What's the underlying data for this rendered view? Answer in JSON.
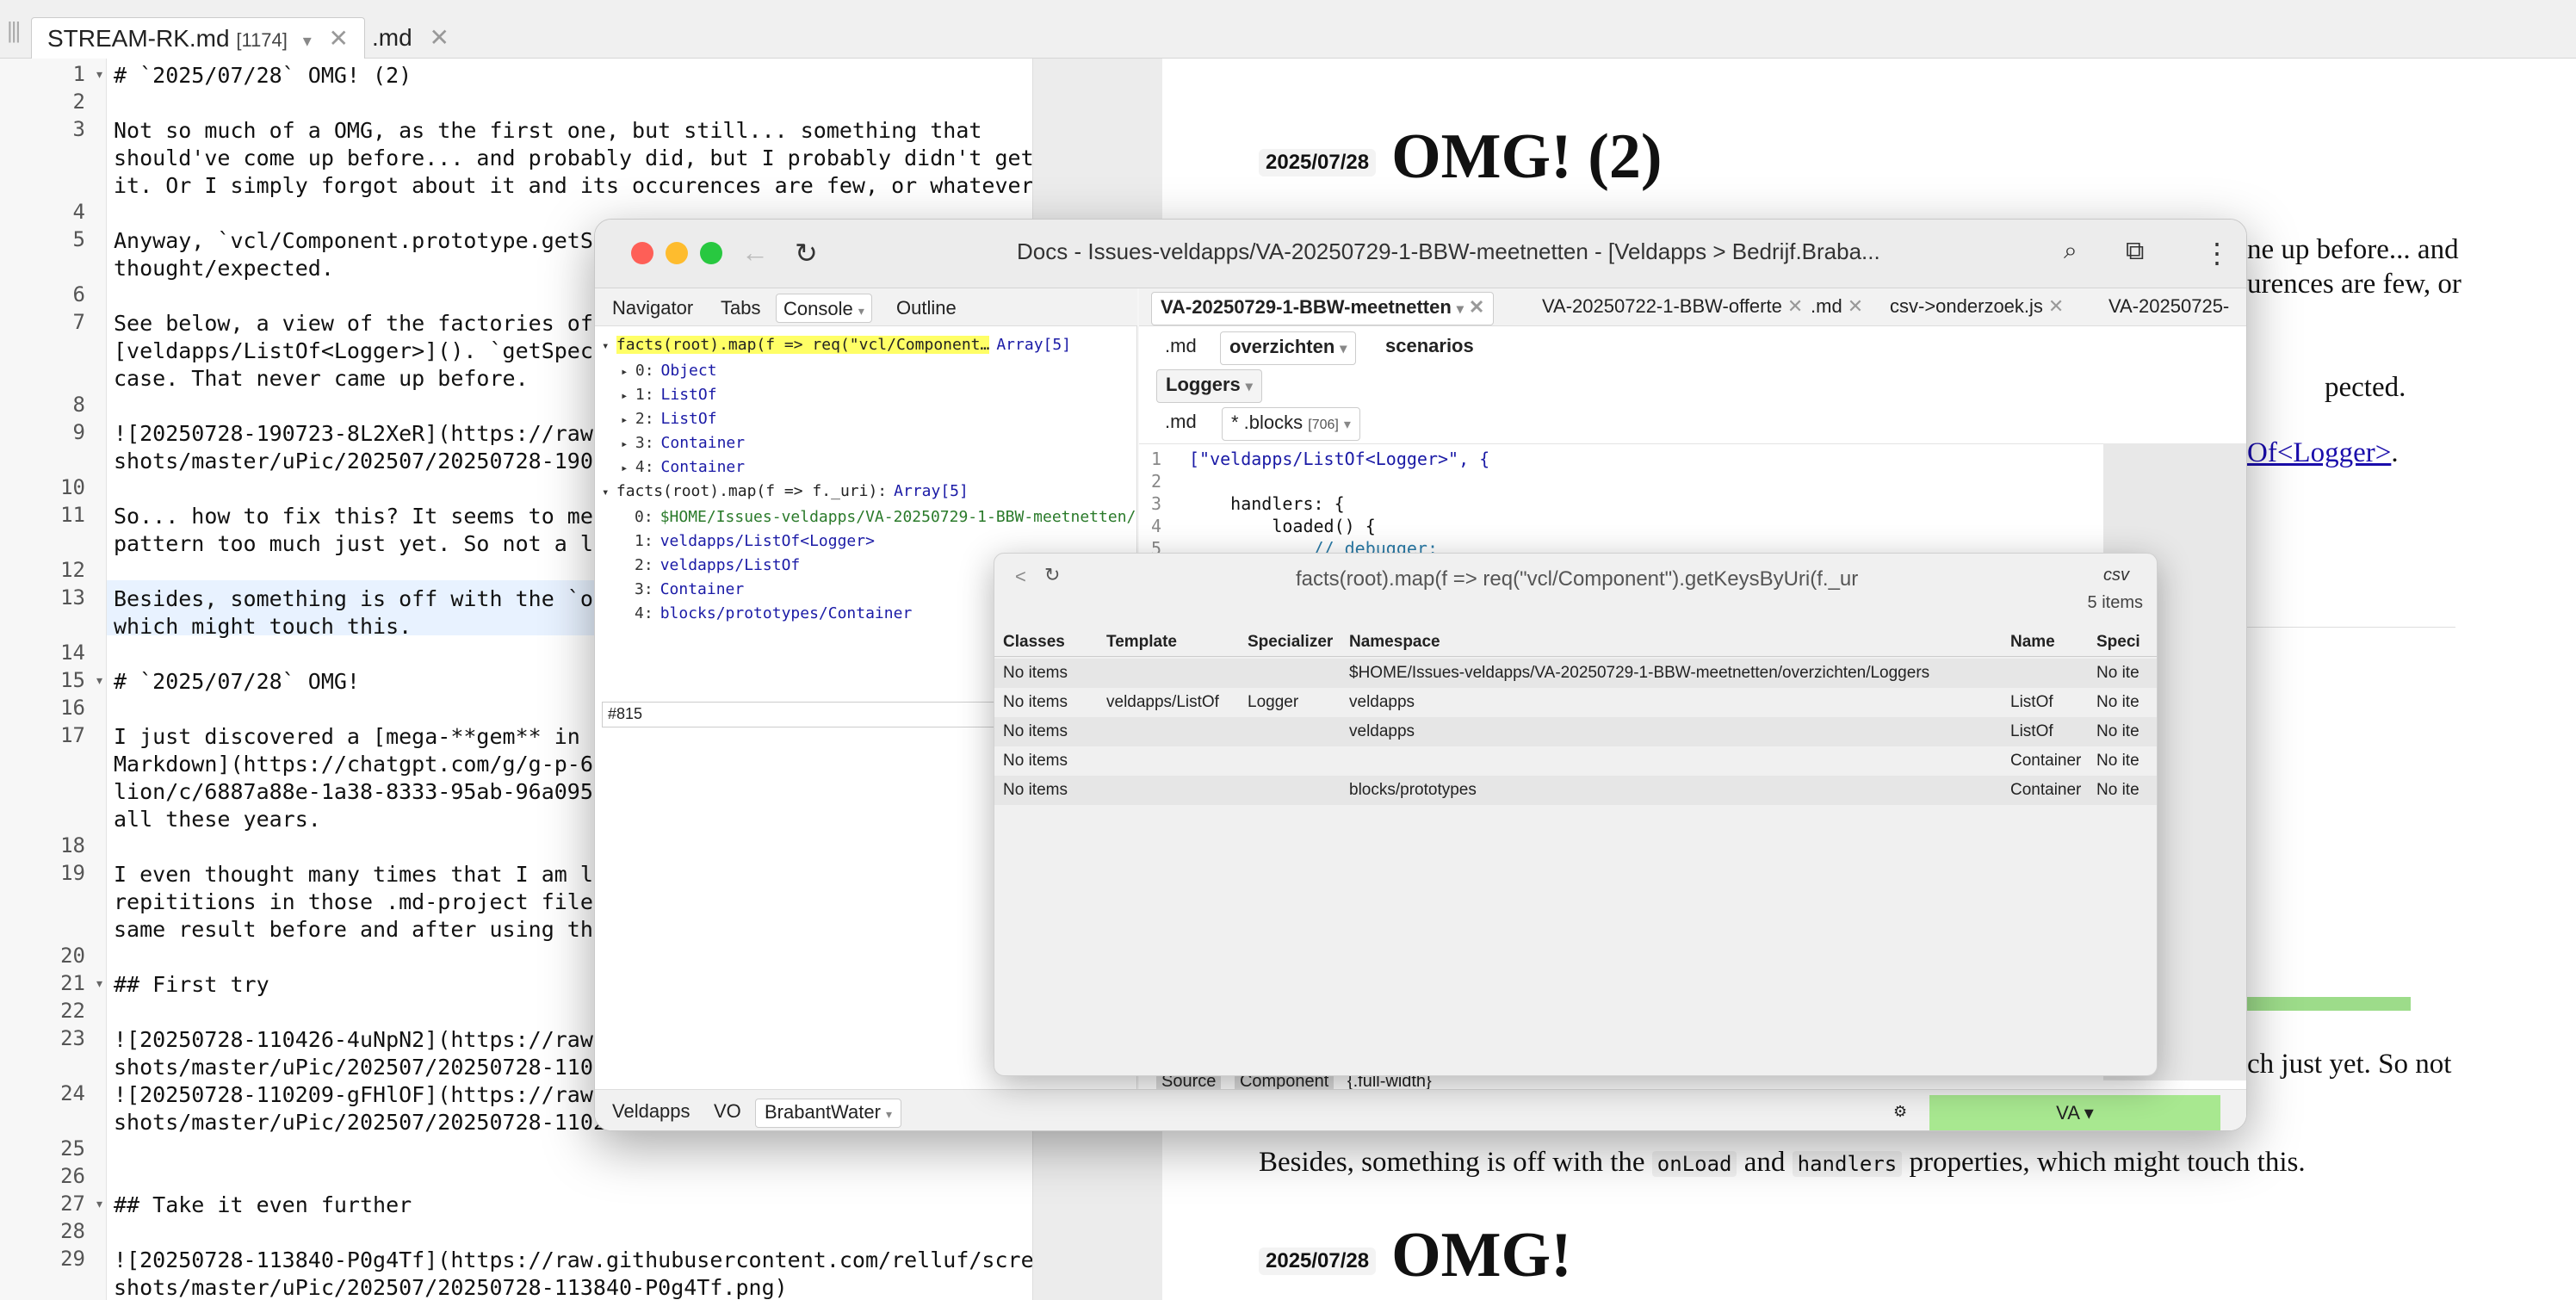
{
  "editor_tabs": [
    {
      "label": "STREAM-RK.md",
      "count": "[1174]",
      "active": true
    },
    {
      "label": ".md",
      "count": "",
      "active": false
    }
  ],
  "editor": {
    "lines": [
      {
        "n": "1",
        "text": "# `2025/07/28` OMG! (2)",
        "fold": true
      },
      {
        "n": "2",
        "text": ""
      },
      {
        "n": "3",
        "text": "Not so much of a OMG, as the first one, but still... something that"
      },
      {
        "n": "",
        "text": "should've come up before... and probably did, but I probably didn't get"
      },
      {
        "n": "",
        "text": "it. Or I simply forgot about it and its occurences are few, or whatever."
      },
      {
        "n": "4",
        "text": ""
      },
      {
        "n": "5",
        "text": "Anyway, `vcl/Component.prototype.getSpe"
      },
      {
        "n": "",
        "text": "thought/expected."
      },
      {
        "n": "6",
        "text": ""
      },
      {
        "n": "7",
        "text": "See below, a view of the factories of a"
      },
      {
        "n": "",
        "text": "[veldapps/ListOf<Logger>](). `getSpecia"
      },
      {
        "n": "",
        "text": "case. That never came up before."
      },
      {
        "n": "8",
        "text": ""
      },
      {
        "n": "9",
        "text": "![20250728-190723-8L2XeR](https://raw.g"
      },
      {
        "n": "",
        "text": "shots/master/uPic/202507/20250728-19072"
      },
      {
        "n": "10",
        "text": ""
      },
      {
        "n": "11",
        "text": "So... how to fix this? It seems to me t"
      },
      {
        "n": "",
        "text": "pattern too much just yet. So not a lot"
      },
      {
        "n": "12",
        "text": ""
      },
      {
        "n": "13",
        "text": "Besides, something is off with the `onL"
      },
      {
        "n": "",
        "text": "which might touch this."
      },
      {
        "n": "14",
        "text": ""
      },
      {
        "n": "15",
        "text": "# `2025/07/28` OMG!",
        "fold": true
      },
      {
        "n": "16",
        "text": ""
      },
      {
        "n": "17",
        "text": "I just discovered a [mega-**gem** in"
      },
      {
        "n": "",
        "text": "Markdown](https://chatgpt.com/g/g-p-685"
      },
      {
        "n": "",
        "text": "lion/c/6887a88e-1a38-8333-95ab-96a09587"
      },
      {
        "n": "",
        "text": "all these years."
      },
      {
        "n": "18",
        "text": ""
      },
      {
        "n": "19",
        "text": "I even thought many times that I am lam"
      },
      {
        "n": "",
        "text": "repititions in those .md-project files."
      },
      {
        "n": "",
        "text": "same result before and after using the"
      },
      {
        "n": "20",
        "text": ""
      },
      {
        "n": "21",
        "text": "## First try",
        "fold": true
      },
      {
        "n": "22",
        "text": ""
      },
      {
        "n": "23",
        "text": "![20250728-110426-4uNpN2](https://raw.g"
      },
      {
        "n": "",
        "text": "shots/master/uPic/202507/20250728-11042"
      },
      {
        "n": "24",
        "text": "![20250728-110209-gFHlOF](https://raw.g"
      },
      {
        "n": "",
        "text": "shots/master/uPic/202507/20250728-11020"
      },
      {
        "n": "25",
        "text": ""
      },
      {
        "n": "26",
        "text": ""
      },
      {
        "n": "27",
        "text": "## Take it even further",
        "fold": true
      },
      {
        "n": "28",
        "text": ""
      },
      {
        "n": "29",
        "text": "![20250728-113840-P0g4Tf](https://raw.githubusercontent.com/relluf/screen"
      },
      {
        "n": "",
        "text": "shots/master/uPic/202507/20250728-113840-P0g4Tf.png)"
      }
    ]
  },
  "preview": {
    "h1_date": "2025/07/28",
    "h1_text": "OMG! (2)",
    "p1a": "ne up before... and",
    "p1b": "urences are few, or",
    "p2": "pected.",
    "link_tail": "Of<Logger>",
    "link_end": ".",
    "p3": "ch just yet. So not",
    "p4_pre": "Besides, something is off with the",
    "p4_code1": "onLoad",
    "p4_and": "and",
    "p4_code2": "handlers",
    "p4_post": "properties, which might touch this.",
    "h2_date": "2025/07/28",
    "h2_text": "OMG!"
  },
  "window": {
    "title": "Docs - Issues-veldapps/VA-20250729-1-BBW-meetnetten - [Veldapps > Bedrijf.Braba...",
    "nav_tabs": [
      "Navigator",
      "Tabs",
      "Console",
      "Outline"
    ],
    "console": [
      {
        "text": "facts(root).map(f => req(\"vcl/Component…",
        "type": "Array[5]"
      },
      {
        "k": "0:",
        "v": "Object"
      },
      {
        "k": "1:",
        "v": "ListOf"
      },
      {
        "k": "2:",
        "v": "ListOf"
      },
      {
        "k": "3:",
        "v": "Container"
      },
      {
        "k": "4:",
        "v": "Container"
      },
      {
        "text": "facts(root).map(f => f._uri):",
        "type": "Array[5]"
      },
      {
        "k": "0:",
        "v": "$HOME/Issues-veldapps/VA-20250729-1-BBW-meetnetten/"
      },
      {
        "k": "1:",
        "v": "veldapps/ListOf<Logger>"
      },
      {
        "k": "2:",
        "v": "veldapps/ListOf"
      },
      {
        "k": "3:",
        "v": "Container"
      },
      {
        "k": "4:",
        "v": "blocks/prototypes/Container"
      }
    ],
    "console_input": "#815",
    "doc_tabs": [
      {
        "label": "VA-20250729-1-BBW-meetnetten",
        "active": true
      },
      {
        "label": "VA-20250722-1-BBW-offerte"
      },
      {
        "label": ".md"
      },
      {
        "label": "csv->onderzoek.js"
      },
      {
        "label": "VA-20250725-"
      }
    ],
    "sub_tabs": [
      ".md",
      "overzichten",
      "scenarios"
    ],
    "loggers_tab": "Loggers",
    "blocks_tabs": [
      ".md",
      "* .blocks",
      "[706]"
    ],
    "code_lines": [
      {
        "n": "1",
        "text": "[\"veldapps/ListOf<Logger>\", {"
      },
      {
        "n": "2",
        "text": ""
      },
      {
        "n": "3",
        "text": "    handlers: {"
      },
      {
        "n": "4",
        "text": "        loaded() {"
      },
      {
        "n": "5",
        "text": "            // debugger;"
      }
    ],
    "bottom_code": [
      "Source",
      "Component",
      "{.full-width}"
    ],
    "status": [
      "Veldapps",
      "VO",
      "BrabantWater"
    ],
    "va_button": "VA ▾"
  },
  "popup": {
    "title": "facts(root).map(f => req(\"vcl/Component\").getKeysByUri(f._ur",
    "format": "csv",
    "count": "5 items",
    "columns": [
      "Classes",
      "Template",
      "Specializer",
      "Namespace",
      "Name",
      "Speci"
    ],
    "rows": [
      [
        "No items",
        "",
        "",
        "$HOME/Issues-veldapps/VA-20250729-1-BBW-meetnetten/overzichten/Loggers",
        "",
        "No ite"
      ],
      [
        "No items",
        "veldapps/ListOf",
        "Logger",
        "veldapps",
        "ListOf",
        "No ite"
      ],
      [
        "No items",
        "",
        "",
        "veldapps",
        "ListOf",
        "No ite"
      ],
      [
        "No items",
        "",
        "",
        "",
        "Container",
        "No ite"
      ],
      [
        "No items",
        "",
        "",
        "blocks/prototypes",
        "Container",
        "No ite"
      ]
    ]
  },
  "colors": {
    "accent_green": "#a8e890",
    "highlight": "#ffff66",
    "link": "#1a1aa6"
  }
}
